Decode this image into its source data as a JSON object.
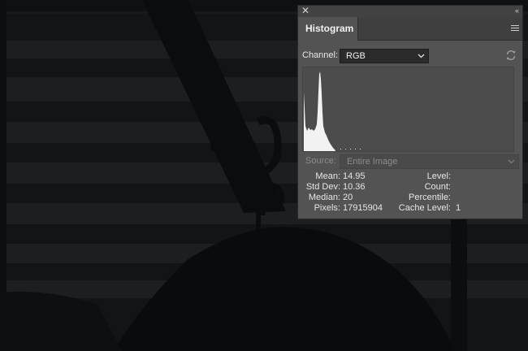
{
  "panel": {
    "tab_label": "Histogram",
    "channel_label": "Channel:",
    "channel_value": "RGB",
    "source_label": "Source:",
    "source_value": "Entire Image",
    "stats": {
      "mean_label": "Mean:",
      "mean_value": "14.95",
      "stddev_label": "Std Dev:",
      "stddev_value": "10.36",
      "median_label": "Median:",
      "median_value": "20",
      "pixels_label": "Pixels:",
      "pixels_value": "17915904",
      "level_label": "Level:",
      "count_label": "Count:",
      "percentile_label": "Percentile:",
      "cache_level_label": "Cache Level:",
      "cache_level_value": "1"
    }
  },
  "icons": {
    "close": "close-icon",
    "collapse": "double-chevron-left-icon",
    "menu": "panel-menu-icon",
    "refresh": "refresh-icon",
    "dropdown": "chevron-down-icon"
  },
  "colors": {
    "panel_bg": "#535353",
    "tab_strip": "#3f3f3f",
    "histogram_fill": "#f2f2f2",
    "photo_bg": "#121314"
  }
}
